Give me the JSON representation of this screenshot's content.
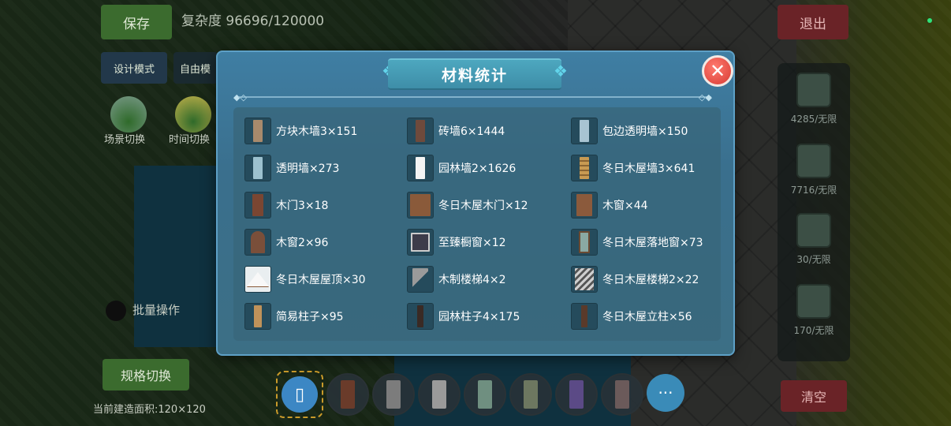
{
  "background": {
    "save_button": "保存",
    "complexity": "复杂度 96696/120000",
    "exit_button": "退出",
    "design_mode": "设计模式",
    "free_mode": "自由模",
    "scene_switch": "场景切换",
    "time_switch": "时间切换",
    "batch_operation": "批量操作",
    "spec_switch": "规格切换",
    "build_area": "当前建造面积:120×120",
    "clear_button": "清空",
    "right_panel": [
      {
        "label": "4285/无限",
        "icon": "stove-block-icon"
      },
      {
        "label": "7716/无限",
        "icon": "wall-block-icon"
      },
      {
        "label": "30/无限",
        "icon": "window-block-icon"
      },
      {
        "label": "170/无限",
        "icon": "pillar-block-icon"
      }
    ],
    "toolbar": {
      "eraser_icon": "eraser-icon",
      "more_label": "···",
      "slot_colors": [
        "#6a3b2a",
        "#7c7c7c",
        "#9a9a9a",
        "#6f8f80",
        "#6d7760",
        "#5b4a86",
        "#6b5a5a"
      ]
    }
  },
  "modal": {
    "title": "材料统计",
    "close_icon": "close-icon",
    "items": [
      {
        "label": "方块木墙3×151",
        "color": "#a88a6c"
      },
      {
        "label": "砖墙6×1444",
        "color": "#6e4a3c"
      },
      {
        "label": "包边透明墙×150",
        "color": "#a8c4d2"
      },
      {
        "label": "透明墙×273",
        "color": "#9cc1cf"
      },
      {
        "label": "园林墙2×1626",
        "color": "#f4f4f4"
      },
      {
        "label": "冬日木屋墙3×641",
        "color": "#c89a52"
      },
      {
        "label": "木门3×18",
        "color": "#7a4632"
      },
      {
        "label": "冬日木屋木门×12",
        "color": "#8a5a3a"
      },
      {
        "label": "木窗×44",
        "color": "#8b5a3c"
      },
      {
        "label": "木窗2×96",
        "color": "#7a4f3a"
      },
      {
        "label": "至臻橱窗×12",
        "color": "#3d3c4a"
      },
      {
        "label": "冬日木屋落地窗×73",
        "color": "#8aa9a3"
      },
      {
        "label": "冬日木屋屋顶×30",
        "color": "#f0f0f0"
      },
      {
        "label": "木制楼梯4×2",
        "color": "#9a9a9a"
      },
      {
        "label": "冬日木屋楼梯2×22",
        "color": "#cfcfcf"
      },
      {
        "label": "简易柱子×95",
        "color": "#c0925a"
      },
      {
        "label": "园林柱子4×175",
        "color": "#3a2a24"
      },
      {
        "label": "冬日木屋立柱×56",
        "color": "#5a3a2a"
      }
    ]
  }
}
